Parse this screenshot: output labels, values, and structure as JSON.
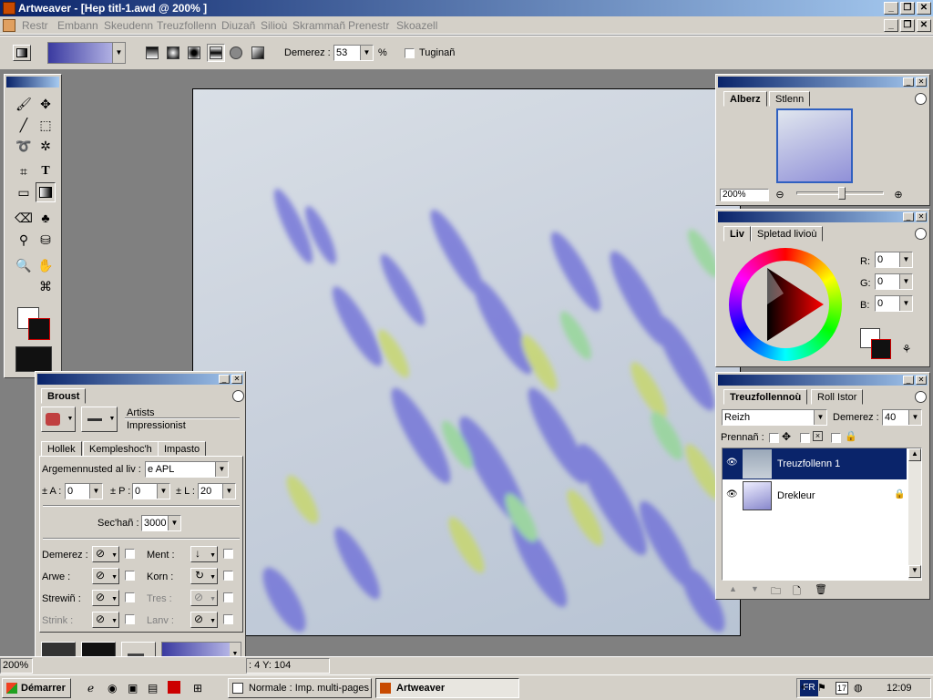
{
  "window": {
    "title": "Artweaver - [Hep titl-1.awd @ 200% ]"
  },
  "menu": [
    "Restr",
    "Embann",
    "Skeudenn",
    "Treuzfollenn",
    "Diuzañ",
    "Silioù",
    "Skrammañ",
    "Prenestr",
    "Skoazell"
  ],
  "options": {
    "opacity_label": "Demerez :",
    "opacity_value": "53",
    "percent": "%",
    "transparent_label": "Tuginañ"
  },
  "navigator": {
    "tabs": [
      "Alberz",
      "Stlenn"
    ],
    "zoom": "200%"
  },
  "color_panel": {
    "tabs": [
      "Liv",
      "Spletad livioù"
    ],
    "r_label": "R:",
    "g_label": "G:",
    "b_label": "B:",
    "r": "0",
    "g": "0",
    "b": "0"
  },
  "layers": {
    "tabs": [
      "Treuzfollennoù",
      "Roll Istor"
    ],
    "mode": "Reizh",
    "opacity_label": "Demerez :",
    "opacity_value": "40",
    "lock_label": "Prennañ :",
    "items": [
      {
        "name": "Treuzfollenn 1",
        "selected": true
      },
      {
        "name": "Drekleur",
        "selected": false
      }
    ]
  },
  "brush": {
    "title": "Broust",
    "category": "Artists",
    "variant": "Impressionist",
    "tabs": [
      "Hollek",
      "Kempleshoc'h",
      "Impasto"
    ],
    "argmen_label": "Argemennusted al liv :",
    "argmen_value": "e APL",
    "a_label": "± A :",
    "a_value": "0",
    "p_label": "± P :",
    "p_value": "0",
    "l_label": "± L :",
    "l_value": "20",
    "seq_label": "Sec'hañ :",
    "seq_value": "3000",
    "rows": [
      {
        "left": "Demerez :",
        "right": "Ment :"
      },
      {
        "left": "Arwe :",
        "right": "Korn :"
      },
      {
        "left": "Strewiñ :",
        "right": "Tres :"
      },
      {
        "left": "Strink :",
        "right": "Lanv :"
      }
    ]
  },
  "status": {
    "zoom": "200%",
    "coords": ": 4  Y: 104"
  },
  "taskbar": {
    "start": "Démarrer",
    "items": [
      "Normale : Imp. multi-pages",
      "Artweaver"
    ],
    "lang": "FR",
    "tray_num": "17",
    "time": "12:09"
  },
  "colors": {
    "title_start": "#0a246a",
    "title_end": "#a6caf0",
    "panel_bg": "#d4d0c8",
    "workspace": "#808080",
    "selected": "#0a246a"
  }
}
